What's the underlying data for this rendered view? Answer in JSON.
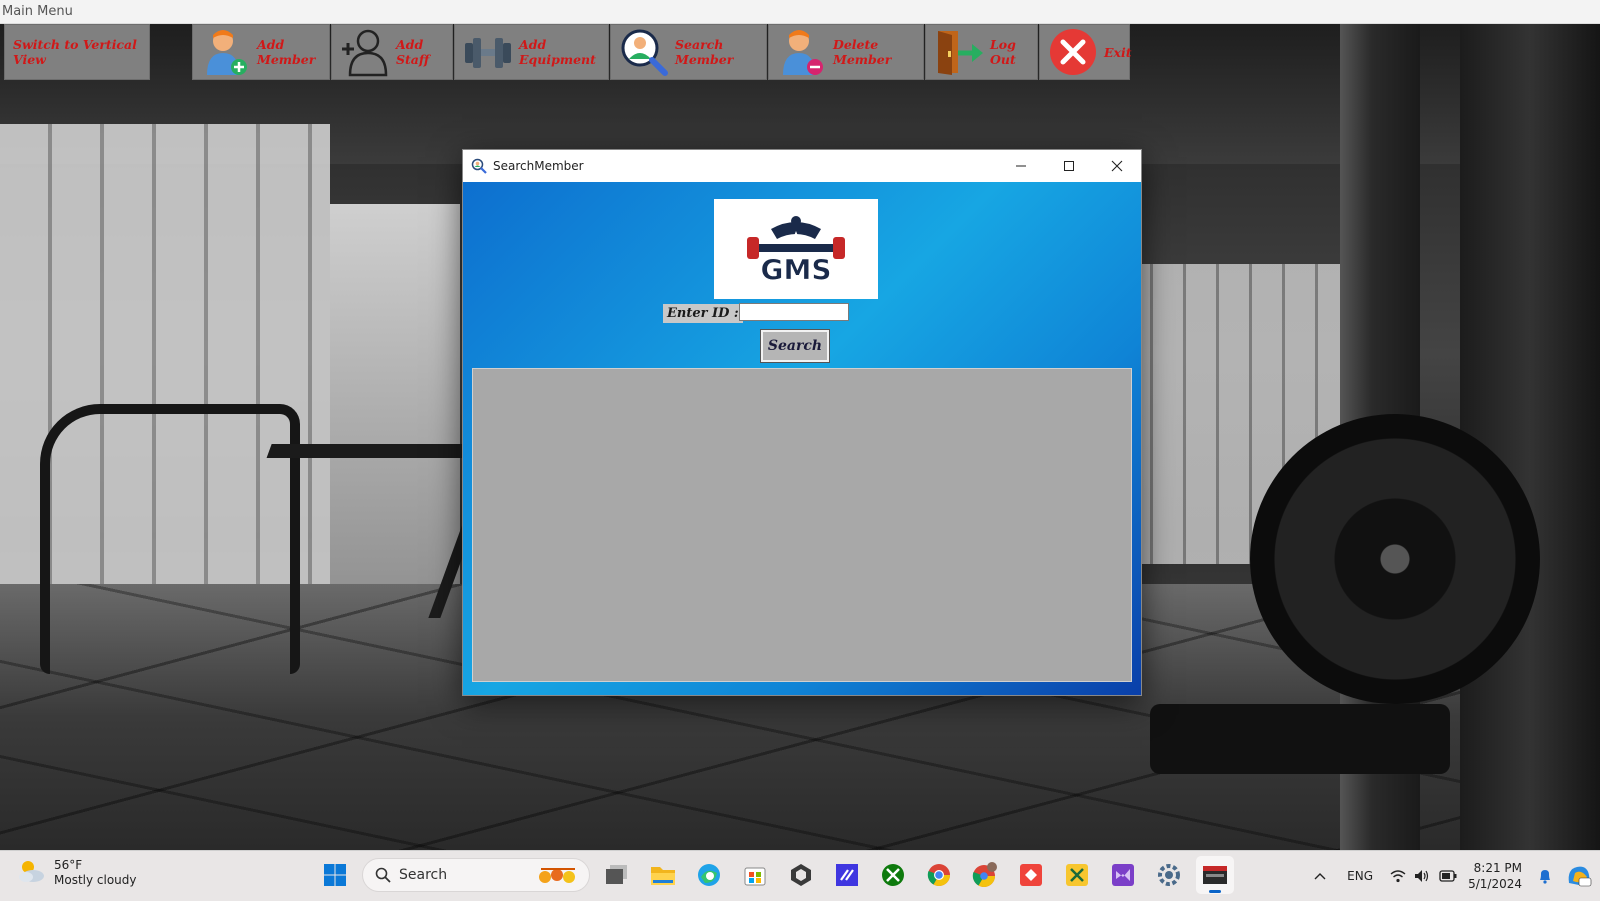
{
  "main_window": {
    "title": "Main Menu"
  },
  "toolbar": {
    "switch_view": "Switch to Vertical View",
    "add_member": "Add Member",
    "add_staff": "Add Staff",
    "add_equipment": "Add Equipment",
    "search_member": "Search Member",
    "delete_member": "Delete Member",
    "log_out": "Log Out",
    "exit": "Exit"
  },
  "dialog": {
    "title": "SearchMember",
    "logo_text": "GMS",
    "enter_id_label": "Enter ID :",
    "id_value": "",
    "search_button": "Search"
  },
  "taskbar": {
    "weather_temp": "56°F",
    "weather_desc": "Mostly cloudy",
    "search_label": "Search",
    "language": "ENG",
    "time": "8:21 PM",
    "date": "5/1/2024",
    "pinned_apps": [
      "start-icon",
      "task-view-icon",
      "file-explorer-icon",
      "edge-icon",
      "microsoft-store-icon",
      "unity-icon",
      "visual-studio-code-icon",
      "xbox-icon",
      "chrome-icon",
      "chrome-profile-icon",
      "anydesk-icon",
      "snipping-tool-icon",
      "visual-studio-icon",
      "settings-icon",
      "gym-app-icon"
    ]
  },
  "colors": {
    "toolbar_bg": "#808080",
    "toolbar_text": "#d01818",
    "dialog_gradient_start": "#0d6fcf",
    "dialog_gradient_mid": "#17a6e3",
    "dialog_gradient_end": "#0a3fa9",
    "results_bg": "#a8a8a8"
  }
}
